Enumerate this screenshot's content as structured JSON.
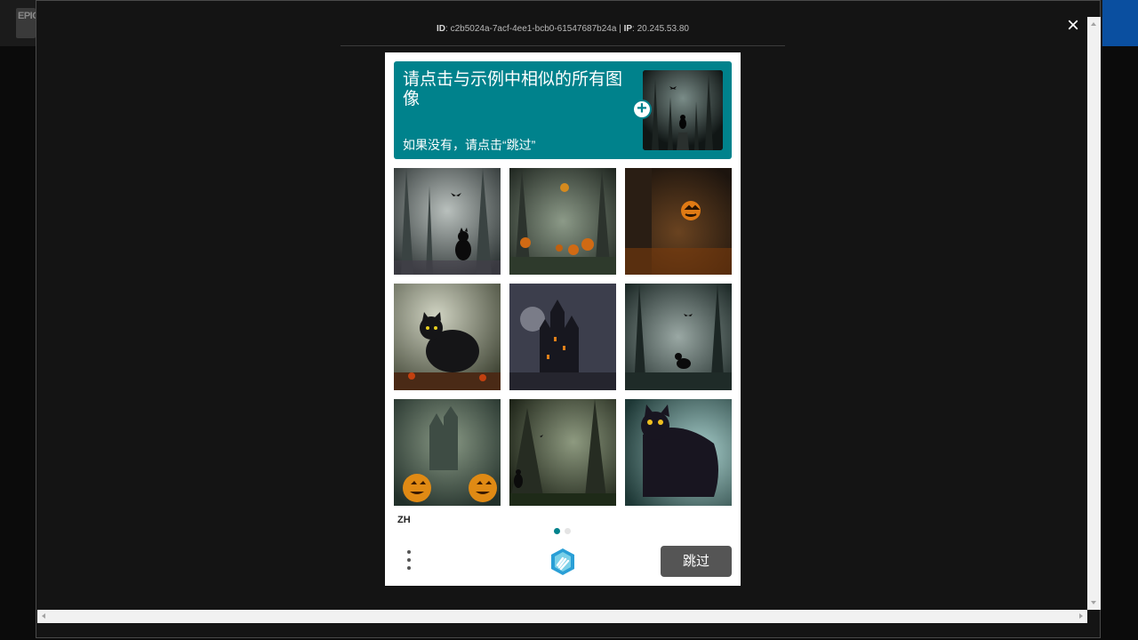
{
  "background": {
    "logo_text": "EPIC"
  },
  "header": {
    "id_prefix": "ID",
    "id_value": ": c2b5024a-7acf-4ee1-bcb0-61547687b24a | ",
    "ip_prefix": "IP",
    "ip_value": ": 20.245.53.80",
    "close_icon": "×"
  },
  "challenge": {
    "title": "请点击与示例中相似的所有图像",
    "instruction": "如果没有，请点击“跳过”",
    "example_icon": "plus-icon",
    "tiles": [
      {
        "name": "forest-cat-bat"
      },
      {
        "name": "forest-pumpkins-lantern"
      },
      {
        "name": "pumpkin-dark-hall"
      },
      {
        "name": "black-cat-sitting"
      },
      {
        "name": "haunted-castle"
      },
      {
        "name": "forest-cat-bats"
      },
      {
        "name": "pumpkins-castle-mist"
      },
      {
        "name": "forest-small-cat"
      },
      {
        "name": "black-cat-yellow-eyes"
      }
    ]
  },
  "footer": {
    "language": "ZH",
    "page_dots": 2,
    "active_dot": 0,
    "verify_label": "跳过"
  },
  "colors": {
    "accent": "#00828c",
    "button": "#555555",
    "page_bg": "#141414"
  }
}
